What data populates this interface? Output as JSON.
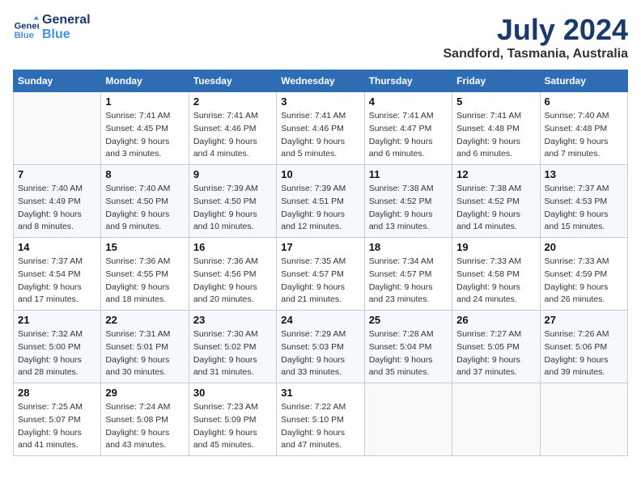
{
  "header": {
    "logo_line1": "General",
    "logo_line2": "Blue",
    "month": "July 2024",
    "location": "Sandford, Tasmania, Australia"
  },
  "columns": [
    "Sunday",
    "Monday",
    "Tuesday",
    "Wednesday",
    "Thursday",
    "Friday",
    "Saturday"
  ],
  "weeks": [
    [
      {
        "day": "",
        "info": ""
      },
      {
        "day": "1",
        "info": "Sunrise: 7:41 AM\nSunset: 4:45 PM\nDaylight: 9 hours\nand 3 minutes."
      },
      {
        "day": "2",
        "info": "Sunrise: 7:41 AM\nSunset: 4:46 PM\nDaylight: 9 hours\nand 4 minutes."
      },
      {
        "day": "3",
        "info": "Sunrise: 7:41 AM\nSunset: 4:46 PM\nDaylight: 9 hours\nand 5 minutes."
      },
      {
        "day": "4",
        "info": "Sunrise: 7:41 AM\nSunset: 4:47 PM\nDaylight: 9 hours\nand 6 minutes."
      },
      {
        "day": "5",
        "info": "Sunrise: 7:41 AM\nSunset: 4:48 PM\nDaylight: 9 hours\nand 6 minutes."
      },
      {
        "day": "6",
        "info": "Sunrise: 7:40 AM\nSunset: 4:48 PM\nDaylight: 9 hours\nand 7 minutes."
      }
    ],
    [
      {
        "day": "7",
        "info": "Sunrise: 7:40 AM\nSunset: 4:49 PM\nDaylight: 9 hours\nand 8 minutes."
      },
      {
        "day": "8",
        "info": "Sunrise: 7:40 AM\nSunset: 4:50 PM\nDaylight: 9 hours\nand 9 minutes."
      },
      {
        "day": "9",
        "info": "Sunrise: 7:39 AM\nSunset: 4:50 PM\nDaylight: 9 hours\nand 10 minutes."
      },
      {
        "day": "10",
        "info": "Sunrise: 7:39 AM\nSunset: 4:51 PM\nDaylight: 9 hours\nand 12 minutes."
      },
      {
        "day": "11",
        "info": "Sunrise: 7:38 AM\nSunset: 4:52 PM\nDaylight: 9 hours\nand 13 minutes."
      },
      {
        "day": "12",
        "info": "Sunrise: 7:38 AM\nSunset: 4:52 PM\nDaylight: 9 hours\nand 14 minutes."
      },
      {
        "day": "13",
        "info": "Sunrise: 7:37 AM\nSunset: 4:53 PM\nDaylight: 9 hours\nand 15 minutes."
      }
    ],
    [
      {
        "day": "14",
        "info": "Sunrise: 7:37 AM\nSunset: 4:54 PM\nDaylight: 9 hours\nand 17 minutes."
      },
      {
        "day": "15",
        "info": "Sunrise: 7:36 AM\nSunset: 4:55 PM\nDaylight: 9 hours\nand 18 minutes."
      },
      {
        "day": "16",
        "info": "Sunrise: 7:36 AM\nSunset: 4:56 PM\nDaylight: 9 hours\nand 20 minutes."
      },
      {
        "day": "17",
        "info": "Sunrise: 7:35 AM\nSunset: 4:57 PM\nDaylight: 9 hours\nand 21 minutes."
      },
      {
        "day": "18",
        "info": "Sunrise: 7:34 AM\nSunset: 4:57 PM\nDaylight: 9 hours\nand 23 minutes."
      },
      {
        "day": "19",
        "info": "Sunrise: 7:33 AM\nSunset: 4:58 PM\nDaylight: 9 hours\nand 24 minutes."
      },
      {
        "day": "20",
        "info": "Sunrise: 7:33 AM\nSunset: 4:59 PM\nDaylight: 9 hours\nand 26 minutes."
      }
    ],
    [
      {
        "day": "21",
        "info": "Sunrise: 7:32 AM\nSunset: 5:00 PM\nDaylight: 9 hours\nand 28 minutes."
      },
      {
        "day": "22",
        "info": "Sunrise: 7:31 AM\nSunset: 5:01 PM\nDaylight: 9 hours\nand 30 minutes."
      },
      {
        "day": "23",
        "info": "Sunrise: 7:30 AM\nSunset: 5:02 PM\nDaylight: 9 hours\nand 31 minutes."
      },
      {
        "day": "24",
        "info": "Sunrise: 7:29 AM\nSunset: 5:03 PM\nDaylight: 9 hours\nand 33 minutes."
      },
      {
        "day": "25",
        "info": "Sunrise: 7:28 AM\nSunset: 5:04 PM\nDaylight: 9 hours\nand 35 minutes."
      },
      {
        "day": "26",
        "info": "Sunrise: 7:27 AM\nSunset: 5:05 PM\nDaylight: 9 hours\nand 37 minutes."
      },
      {
        "day": "27",
        "info": "Sunrise: 7:26 AM\nSunset: 5:06 PM\nDaylight: 9 hours\nand 39 minutes."
      }
    ],
    [
      {
        "day": "28",
        "info": "Sunrise: 7:25 AM\nSunset: 5:07 PM\nDaylight: 9 hours\nand 41 minutes."
      },
      {
        "day": "29",
        "info": "Sunrise: 7:24 AM\nSunset: 5:08 PM\nDaylight: 9 hours\nand 43 minutes."
      },
      {
        "day": "30",
        "info": "Sunrise: 7:23 AM\nSunset: 5:09 PM\nDaylight: 9 hours\nand 45 minutes."
      },
      {
        "day": "31",
        "info": "Sunrise: 7:22 AM\nSunset: 5:10 PM\nDaylight: 9 hours\nand 47 minutes."
      },
      {
        "day": "",
        "info": ""
      },
      {
        "day": "",
        "info": ""
      },
      {
        "day": "",
        "info": ""
      }
    ]
  ]
}
